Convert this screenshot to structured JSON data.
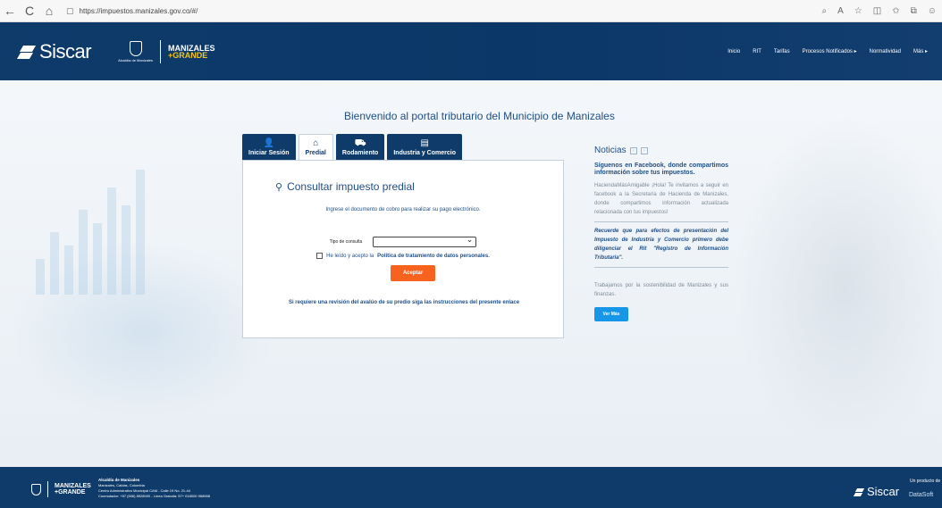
{
  "browser": {
    "url": "https://impuestos.manizales.gov.co/#/",
    "back_icon": "←",
    "refresh_icon": "C",
    "home_icon": "⌂"
  },
  "header": {
    "brand": "Siscar",
    "alcaldia": "Alcaldía de Manizales",
    "manizales_line1": "MANIZALES",
    "manizales_line2": "+GRANDE",
    "nav": [
      "Inicio",
      "RIT",
      "Tarifas",
      "Procesos Notificados ▸",
      "Normatividad",
      "Más ▸"
    ]
  },
  "main": {
    "welcome": "Bienvenido al portal tributario del Municipio de Manizales",
    "tabs": [
      {
        "label": "Iniciar Sesión",
        "icon": "person-icon"
      },
      {
        "label": "Predial",
        "icon": "home-icon"
      },
      {
        "label": "Rodamiento",
        "icon": "car-icon"
      },
      {
        "label": "Industria y Comercio",
        "icon": "document-icon"
      }
    ],
    "form": {
      "title": "Consultar impuesto predial",
      "subtitle": "Ingrese el documento de cobro para realizar su pago electrónico.",
      "query_label": "Tipo de consulta",
      "query_value": "",
      "terms_prefix": "He leído y acepto la",
      "terms_link": "Política de tratamiento de datos personales.",
      "accept": "Aceptar",
      "notice": "Si requiere una revisión del avalúo de su predio siga las instrucciones del presente enlace"
    }
  },
  "news": {
    "title": "Noticias",
    "headline": "Síguenos en Facebook, donde compartimos información sobre tus impuestos.",
    "body": "HaciendaMásAmigable ¡Hola! Te invitamos a seguir en facebook a la Secretaría de Hacienda de Manizales, donde compartimos información actualizada relacionada con tus impuestos!",
    "reminder": "Recuerde que para efectos de presentación del Impuesto de Industria y Comercio primero debe diligenciar el Rit \"Registro de Información Tributaria\".",
    "sustain": "Trabajamos por la sostenibilidad de Manizales y sus finanzas.",
    "more": "Ver Más"
  },
  "footer": {
    "alcaldia": "Alcaldía de Manizales",
    "mg1": "MANIZALES",
    "mg2": "+GRANDE",
    "info_title": "Alcaldía de Manizales",
    "info_lines": [
      "Manizales, Caldas, Colombia",
      "Centro Administrativo Municipal CAM - Calle 19 No. 21-44",
      "Conmutador: +57 (606) 8928000 - Línea Gratuita: 57+ 018000 968988"
    ],
    "brand": "Siscar",
    "product": "Un producto de",
    "datasoft": "DataSoft"
  },
  "colors": {
    "navy": "#0f3b6b",
    "accent_orange": "#f7631e",
    "accent_blue": "#1696e6",
    "text_blue": "#1f4f86"
  }
}
